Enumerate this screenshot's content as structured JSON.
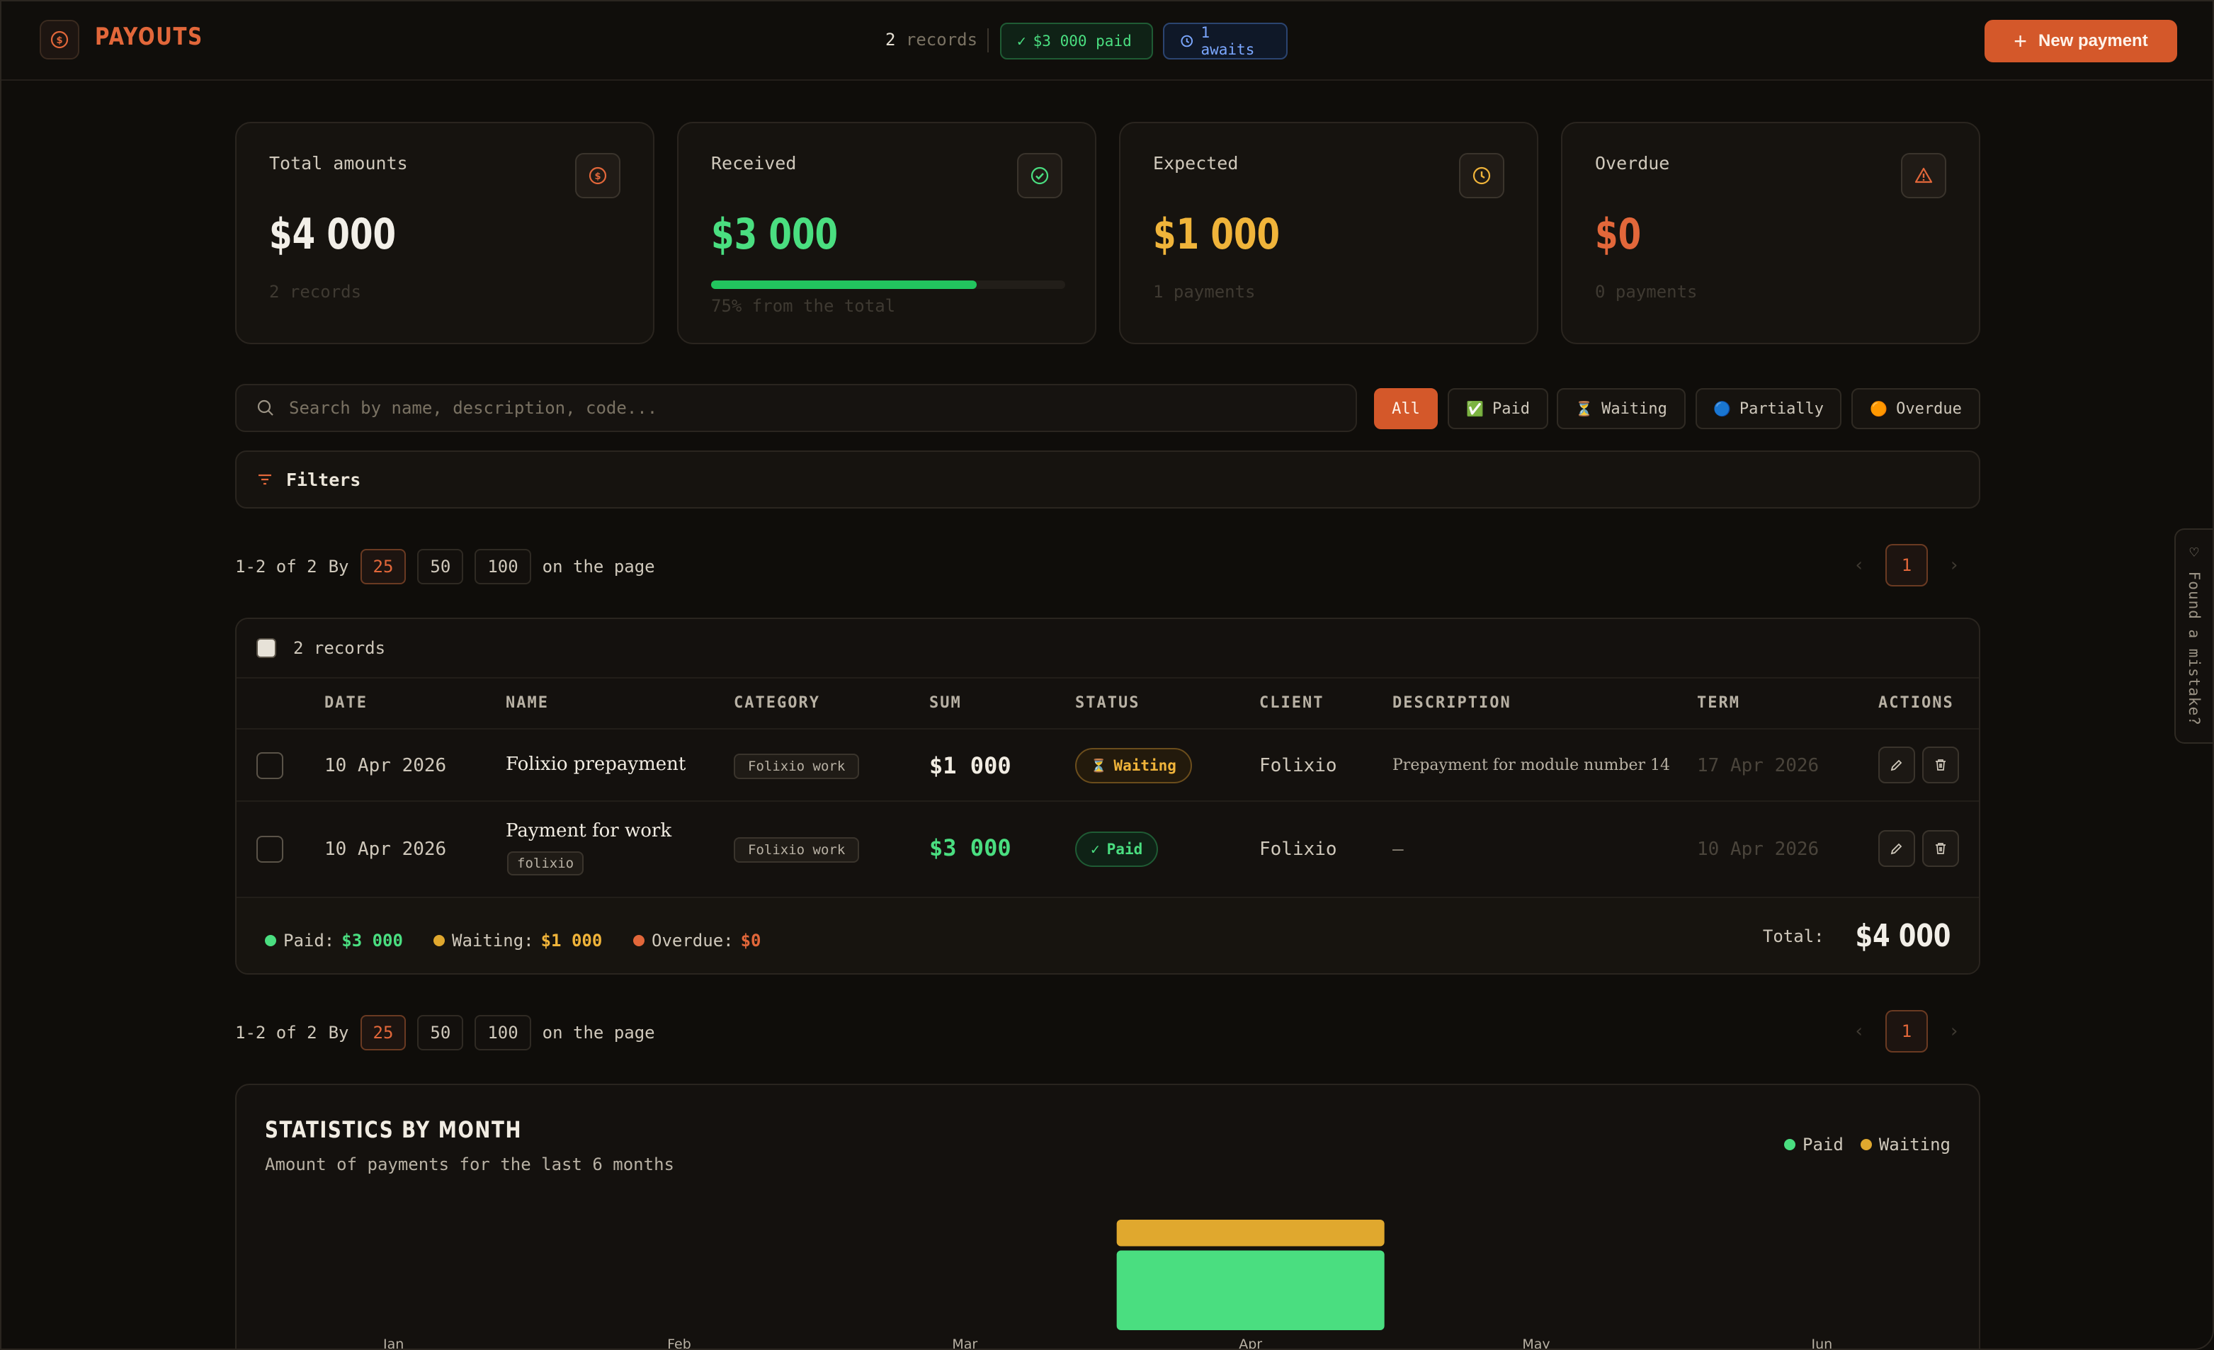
{
  "app": {
    "title": "PAYOUTS",
    "icon": "dollar-circle-icon"
  },
  "header": {
    "records_count": "2",
    "records_label": "records",
    "paid_pill": "$3 000 paid",
    "awaits_pill": "1 awaits",
    "new_payment": "New payment"
  },
  "stats": [
    {
      "label": "Total amounts",
      "value": "$4 000",
      "sub": "2 records",
      "icon": "dollar-circle-icon",
      "color": "#f2efe8"
    },
    {
      "label": "Received",
      "value": "$3 000",
      "sub": "75% from the total",
      "icon": "check-circle-icon",
      "color": "#4ade80",
      "progress": 0.75
    },
    {
      "label": "Expected",
      "value": "$1 000",
      "sub": "1 payments",
      "icon": "clock-icon",
      "color": "#f0b43a"
    },
    {
      "label": "Overdue",
      "value": "$0",
      "sub": "0 payments",
      "icon": "warning-triangle-icon",
      "color": "#e2673a"
    }
  ],
  "search": {
    "placeholder": "Search by name, description, code..."
  },
  "status_filters": [
    {
      "label": "All",
      "active": true
    },
    {
      "label": "Paid",
      "icon": "✅"
    },
    {
      "label": "Waiting",
      "icon": "⏳"
    },
    {
      "label": "Partially",
      "icon": "🔵"
    },
    {
      "label": "Overdue",
      "icon": "🟠"
    }
  ],
  "filters": {
    "label": "Filters"
  },
  "pagination": {
    "range": "1-2 of 2",
    "by": "By",
    "sizes": [
      "25",
      "50",
      "100"
    ],
    "selected_size": "25",
    "suffix": "on the page",
    "current_page": "1"
  },
  "table": {
    "records_label": "2 records",
    "columns": [
      "DATE",
      "NAME",
      "CATEGORY",
      "SUM",
      "STATUS",
      "CLIENT",
      "DESCRIPTION",
      "TERM",
      "ACTIONS"
    ],
    "rows": [
      {
        "date": "10 Apr 2026",
        "name": "Folixio prepayment",
        "category": "Folixio work",
        "sum": "$1 000",
        "status": "Waiting",
        "status_icon": "⏳",
        "client": "Folixio",
        "description": "Prepayment for module number 14",
        "term": "17 Apr 2026"
      },
      {
        "date": "10 Apr 2026",
        "name": "Payment for work",
        "tag": "folixio",
        "category": "Folixio work",
        "sum": "$3 000",
        "status": "Paid",
        "status_icon": "✓",
        "client": "Folixio",
        "description": "—",
        "term": "10 Apr 2026"
      }
    ],
    "footer": {
      "paid_label": "Paid:",
      "paid_value": "$3 000",
      "waiting_label": "Waiting:",
      "waiting_value": "$1 000",
      "overdue_label": "Overdue:",
      "overdue_value": "$0",
      "total_label": "Total:",
      "total_value": "$4 000"
    }
  },
  "feedback": {
    "label": "Found a mistake?"
  },
  "colors": {
    "accent": "#d4582a",
    "paid": "#4ade80",
    "waiting": "#e0a82e",
    "overdue": "#e2673a"
  },
  "chart_data": {
    "type": "bar",
    "title": "STATISTICS BY MONTH",
    "subtitle": "Amount of payments for the last 6 months",
    "stacked": true,
    "categories": [
      "Jan",
      "Feb",
      "Mar",
      "Apr",
      "May",
      "Jun"
    ],
    "series": [
      {
        "name": "Paid",
        "color": "#4ade80",
        "values": [
          0,
          0,
          0,
          3000,
          0,
          0
        ]
      },
      {
        "name": "Waiting",
        "color": "#e0a82e",
        "values": [
          0,
          0,
          0,
          1000,
          0,
          0
        ]
      }
    ],
    "ylim": [
      0,
      4000
    ],
    "legend": "top-right",
    "grid": false
  }
}
